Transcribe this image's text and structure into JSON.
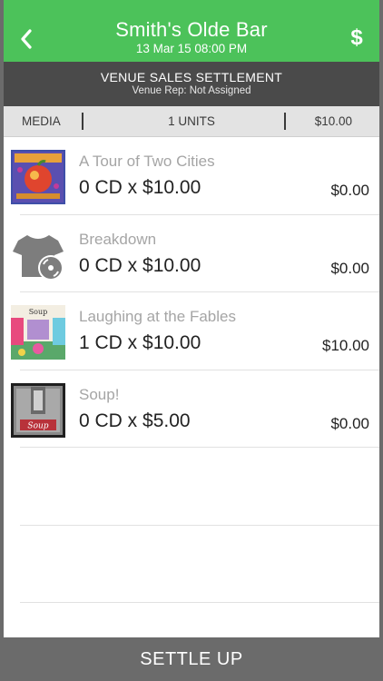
{
  "header": {
    "title": "Smith's Olde Bar",
    "subtitle": "13 Mar 15  08:00 PM",
    "dollar_label": "$",
    "background": "#4cc25a"
  },
  "banner": {
    "title": "VENUE SALES SETTLEMENT",
    "subtitle": "Venue Rep: Not Assigned"
  },
  "columns": {
    "media": "MEDIA",
    "units": "1 UNITS",
    "total": "$10.00"
  },
  "items": [
    {
      "name": "A Tour of Two Cities",
      "qty": "0 CD x $10.00",
      "amount": "$0.00",
      "icon": "album-cover-tour"
    },
    {
      "name": "Breakdown",
      "qty": "0 CD x $10.00",
      "amount": "$0.00",
      "icon": "tshirt-cd-icon"
    },
    {
      "name": "Laughing at the Fables",
      "qty": "1 CD x $10.00",
      "amount": "$10.00",
      "icon": "album-cover-fables"
    },
    {
      "name": "Soup!",
      "qty": "0 CD x $5.00",
      "amount": "$0.00",
      "icon": "album-cover-soup"
    }
  ],
  "footer": {
    "settle_label": "SETTLE UP"
  }
}
